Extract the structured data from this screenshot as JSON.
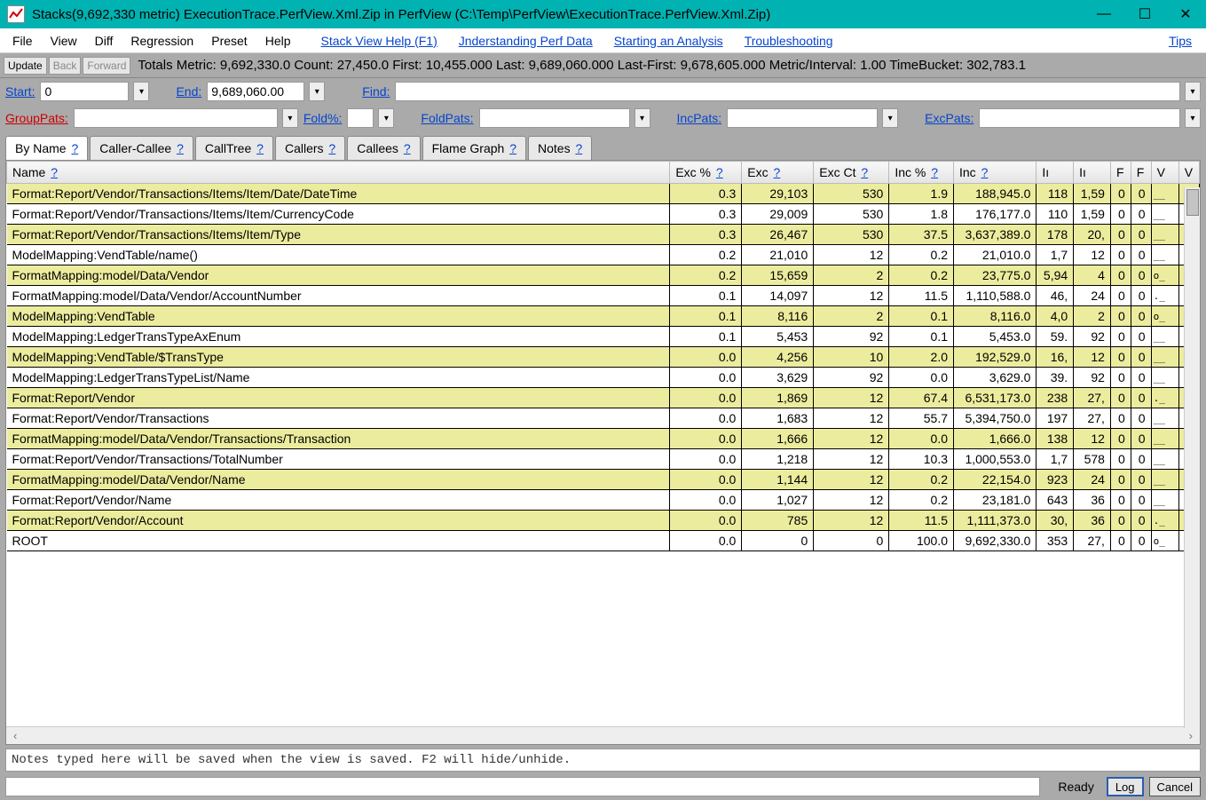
{
  "window": {
    "title": "Stacks(9,692,330 metric) ExecutionTrace.PerfView.Xml.Zip in PerfView (C:\\Temp\\PerfView\\ExecutionTrace.PerfView.Xml.Zip)",
    "min": "—",
    "max": "☐",
    "close": "✕"
  },
  "menu": {
    "items": [
      "File",
      "View",
      "Diff",
      "Regression",
      "Preset",
      "Help"
    ],
    "links": [
      "Stack View Help (F1)",
      "Jnderstanding Perf Data",
      "Starting an Analysis",
      "Troubleshooting",
      "Tips"
    ]
  },
  "totals": {
    "update": "Update",
    "back": "Back",
    "forward": "Forward",
    "text": "Totals Metric: 9,692,330.0  Count: 27,450.0  First: 10,455.000 Last: 9,689,060.000  Last-First: 9,678,605.000  Metric/Interval: 1.00  TimeBucket: 302,783.1"
  },
  "filters1": {
    "start_label": "Start:",
    "start_value": "0",
    "end_label": "End:",
    "end_value": "9,689,060.00",
    "find_label": "Find:",
    "find_value": ""
  },
  "filters2": {
    "grouppats_label": "GroupPats:",
    "foldpct_label": "Fold%:",
    "foldpats_label": "FoldPats:",
    "incpats_label": "IncPats:",
    "excpats_label": "ExcPats:"
  },
  "tabs": [
    "By Name",
    "Caller-Callee",
    "CallTree",
    "Callers",
    "Callees",
    "Flame Graph",
    "Notes"
  ],
  "active_tab": 0,
  "columns": [
    "Name",
    "Exc %",
    "Exc",
    "Exc Ct",
    "Inc %",
    "Inc",
    "Iı",
    "Iı",
    "F",
    "F",
    "V",
    "V"
  ],
  "rows": [
    {
      "name": "Format:Report/Vendor/Transactions/Items/Item/Date/DateTime",
      "excp": "0.3",
      "exc": "29,103",
      "excct": "530",
      "incp": "1.9",
      "inc": "188,945.0",
      "c6": "118",
      "c7": "1,59",
      "c8": "0",
      "c9": "0",
      "sp": "__"
    },
    {
      "name": "Format:Report/Vendor/Transactions/Items/Item/CurrencyCode",
      "excp": "0.3",
      "exc": "29,009",
      "excct": "530",
      "incp": "1.8",
      "inc": "176,177.0",
      "c6": "110",
      "c7": "1,59",
      "c8": "0",
      "c9": "0",
      "sp": "__"
    },
    {
      "name": "Format:Report/Vendor/Transactions/Items/Item/Type",
      "excp": "0.3",
      "exc": "26,467",
      "excct": "530",
      "incp": "37.5",
      "inc": "3,637,389.0",
      "c6": "178",
      "c7": "20,",
      "c8": "0",
      "c9": "0",
      "sp": "__"
    },
    {
      "name": "ModelMapping:VendTable/name()",
      "excp": "0.2",
      "exc": "21,010",
      "excct": "12",
      "incp": "0.2",
      "inc": "21,010.0",
      "c6": "1,7",
      "c7": "12",
      "c8": "0",
      "c9": "0",
      "sp": "__"
    },
    {
      "name": "FormatMapping:model/Data/Vendor",
      "excp": "0.2",
      "exc": "15,659",
      "excct": "2",
      "incp": "0.2",
      "inc": "23,775.0",
      "c6": "5,94",
      "c7": "4",
      "c8": "0",
      "c9": "0",
      "sp": "o_"
    },
    {
      "name": "FormatMapping:model/Data/Vendor/AccountNumber",
      "excp": "0.1",
      "exc": "14,097",
      "excct": "12",
      "incp": "11.5",
      "inc": "1,110,588.0",
      "c6": "46,",
      "c7": "24",
      "c8": "0",
      "c9": "0",
      "sp": "._"
    },
    {
      "name": "ModelMapping:VendTable",
      "excp": "0.1",
      "exc": "8,116",
      "excct": "2",
      "incp": "0.1",
      "inc": "8,116.0",
      "c6": "4,0",
      "c7": "2",
      "c8": "0",
      "c9": "0",
      "sp": "o_"
    },
    {
      "name": "ModelMapping:LedgerTransTypeAxEnum",
      "excp": "0.1",
      "exc": "5,453",
      "excct": "92",
      "incp": "0.1",
      "inc": "5,453.0",
      "c6": "59.",
      "c7": "92",
      "c8": "0",
      "c9": "0",
      "sp": "__"
    },
    {
      "name": "ModelMapping:VendTable/$TransType",
      "excp": "0.0",
      "exc": "4,256",
      "excct": "10",
      "incp": "2.0",
      "inc": "192,529.0",
      "c6": "16,",
      "c7": "12",
      "c8": "0",
      "c9": "0",
      "sp": "__"
    },
    {
      "name": "ModelMapping:LedgerTransTypeList/Name",
      "excp": "0.0",
      "exc": "3,629",
      "excct": "92",
      "incp": "0.0",
      "inc": "3,629.0",
      "c6": "39.",
      "c7": "92",
      "c8": "0",
      "c9": "0",
      "sp": "__"
    },
    {
      "name": "Format:Report/Vendor",
      "excp": "0.0",
      "exc": "1,869",
      "excct": "12",
      "incp": "67.4",
      "inc": "6,531,173.0",
      "c6": "238",
      "c7": "27,",
      "c8": "0",
      "c9": "0",
      "sp": "._"
    },
    {
      "name": "Format:Report/Vendor/Transactions",
      "excp": "0.0",
      "exc": "1,683",
      "excct": "12",
      "incp": "55.7",
      "inc": "5,394,750.0",
      "c6": "197",
      "c7": "27,",
      "c8": "0",
      "c9": "0",
      "sp": "__"
    },
    {
      "name": "FormatMapping:model/Data/Vendor/Transactions/Transaction",
      "excp": "0.0",
      "exc": "1,666",
      "excct": "12",
      "incp": "0.0",
      "inc": "1,666.0",
      "c6": "138",
      "c7": "12",
      "c8": "0",
      "c9": "0",
      "sp": "__"
    },
    {
      "name": "Format:Report/Vendor/Transactions/TotalNumber",
      "excp": "0.0",
      "exc": "1,218",
      "excct": "12",
      "incp": "10.3",
      "inc": "1,000,553.0",
      "c6": "1,7",
      "c7": "578",
      "c8": "0",
      "c9": "0",
      "sp": "__"
    },
    {
      "name": "FormatMapping:model/Data/Vendor/Name",
      "excp": "0.0",
      "exc": "1,144",
      "excct": "12",
      "incp": "0.2",
      "inc": "22,154.0",
      "c6": "923",
      "c7": "24",
      "c8": "0",
      "c9": "0",
      "sp": "__"
    },
    {
      "name": "Format:Report/Vendor/Name",
      "excp": "0.0",
      "exc": "1,027",
      "excct": "12",
      "incp": "0.2",
      "inc": "23,181.0",
      "c6": "643",
      "c7": "36",
      "c8": "0",
      "c9": "0",
      "sp": "__"
    },
    {
      "name": "Format:Report/Vendor/Account",
      "excp": "0.0",
      "exc": "785",
      "excct": "12",
      "incp": "11.5",
      "inc": "1,111,373.0",
      "c6": "30,",
      "c7": "36",
      "c8": "0",
      "c9": "0",
      "sp": "._"
    },
    {
      "name": "ROOT",
      "excp": "0.0",
      "exc": "0",
      "excct": "0",
      "incp": "100.0",
      "inc": "9,692,330.0",
      "c6": "353",
      "c7": "27,",
      "c8": "0",
      "c9": "0",
      "sp": "o_"
    }
  ],
  "notes_placeholder": "Notes typed here will be saved when the view is saved. F2 will hide/unhide.",
  "status": {
    "ready": "Ready",
    "log": "Log",
    "cancel": "Cancel"
  }
}
